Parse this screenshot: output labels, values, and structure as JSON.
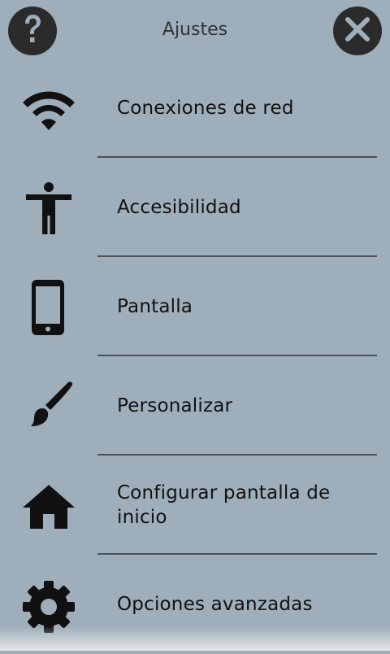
{
  "header": {
    "title": "Ajustes",
    "help_icon": "question-mark-icon",
    "close_icon": "close-icon"
  },
  "menu": {
    "items": [
      {
        "label": "Conexiones de red",
        "icon": "wifi-icon"
      },
      {
        "label": "Accesibilidad",
        "icon": "accessibility-icon"
      },
      {
        "label": "Pantalla",
        "icon": "phone-icon"
      },
      {
        "label": "Personalizar",
        "icon": "brush-icon"
      },
      {
        "label": "Configurar pantalla de inicio",
        "icon": "home-icon"
      },
      {
        "label": "Opciones avanzadas",
        "icon": "gear-icon"
      }
    ]
  },
  "colors": {
    "background": "#9eaeba",
    "button": "#2b2b2b",
    "divider": "#4a5157"
  }
}
